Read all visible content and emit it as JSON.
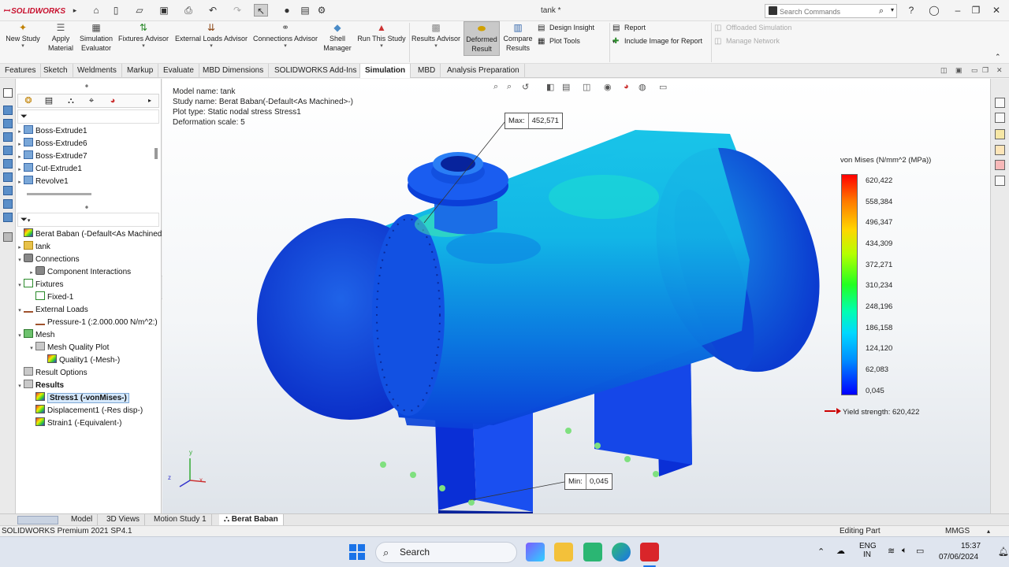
{
  "app": {
    "logo": "SOLIDWORKS",
    "doc_title": "tank *"
  },
  "search": {
    "placeholder": "Search Commands"
  },
  "ribbon": {
    "new_study": [
      "New Study"
    ],
    "apply_material": [
      "Apply",
      "Material"
    ],
    "simulation_evaluator": [
      "Simulation",
      "Evaluator"
    ],
    "fixtures_advisor": [
      "Fixtures Advisor"
    ],
    "external_loads_advisor": [
      "External Loads Advisor"
    ],
    "connections_advisor": [
      "Connections Advisor"
    ],
    "shell_manager": [
      "Shell",
      "Manager"
    ],
    "run_this_study": [
      "Run This Study"
    ],
    "results_advisor": [
      "Results Advisor"
    ],
    "deformed_result": [
      "Deformed",
      "Result"
    ],
    "compare_results": [
      "Compare",
      "Results"
    ],
    "design_insight": "Design Insight",
    "plot_tools": "Plot Tools",
    "report": "Report",
    "include_image": "Include Image for Report",
    "offloaded_simulation": "Offloaded Simulation",
    "manage_network": "Manage Network"
  },
  "command_tabs": [
    "Features",
    "Sketch",
    "Weldments",
    "Markup",
    "Evaluate",
    "MBD Dimensions",
    "SOLIDWORKS Add-Ins",
    "Simulation",
    "MBD",
    "Analysis Preparation"
  ],
  "active_tab": "Simulation",
  "feature_tree": {
    "items": [
      "Boss-Extrude1",
      "Boss-Extrude6",
      "Boss-Extrude7",
      "Cut-Extrude1",
      "Revolve1"
    ]
  },
  "study_tree": {
    "root": "Berat Baban (-Default<As Machined>",
    "part": "tank",
    "connections": "Connections",
    "component_interactions": "Component Interactions",
    "fixtures": "Fixtures",
    "fixed1": "Fixed-1",
    "external_loads": "External Loads",
    "pressure1": "Pressure-1 (:2.000.000 N/m^2:)",
    "mesh": "Mesh",
    "mesh_quality_plot": "Mesh Quality Plot",
    "quality1": "Quality1 (-Mesh-)",
    "result_options": "Result Options",
    "results": "Results",
    "stress1": "Stress1 (-vonMises-)",
    "displacement1": "Displacement1 (-Res disp-)",
    "strain1": "Strain1 (-Equivalent-)"
  },
  "viewport": {
    "model_name": "Model name: tank",
    "study_name": "Study name: Berat Baban(-Default<As Machined>-)",
    "plot_type": "Plot type: Static nodal stress Stress1",
    "deformation_scale": "Deformation scale: 5",
    "max_label": "Max:",
    "max_value": "452,571",
    "min_label": "Min:",
    "min_value": "0,045"
  },
  "legend": {
    "title": "von Mises (N/mm^2 (MPa))",
    "values": [
      "620,422",
      "558,384",
      "496,347",
      "434,309",
      "372,271",
      "310,234",
      "248,196",
      "186,158",
      "124,120",
      "62,083",
      "0,045"
    ],
    "yield": "Yield strength: 620,422",
    "colors": {
      "max": "#ff0000",
      "min": "#0000ff"
    }
  },
  "bottom_tabs": [
    "Model",
    "3D Views",
    "Motion Study 1",
    "Berat Baban"
  ],
  "active_bottom_tab": "Berat Baban",
  "status": {
    "product": "SOLIDWORKS Premium 2021 SP4.1",
    "mode": "Editing Part",
    "units": "MMGS"
  },
  "taskbar": {
    "search": "Search",
    "lang1": "ENG",
    "lang2": "IN",
    "time": "15:37",
    "date": "07/06/2024"
  }
}
